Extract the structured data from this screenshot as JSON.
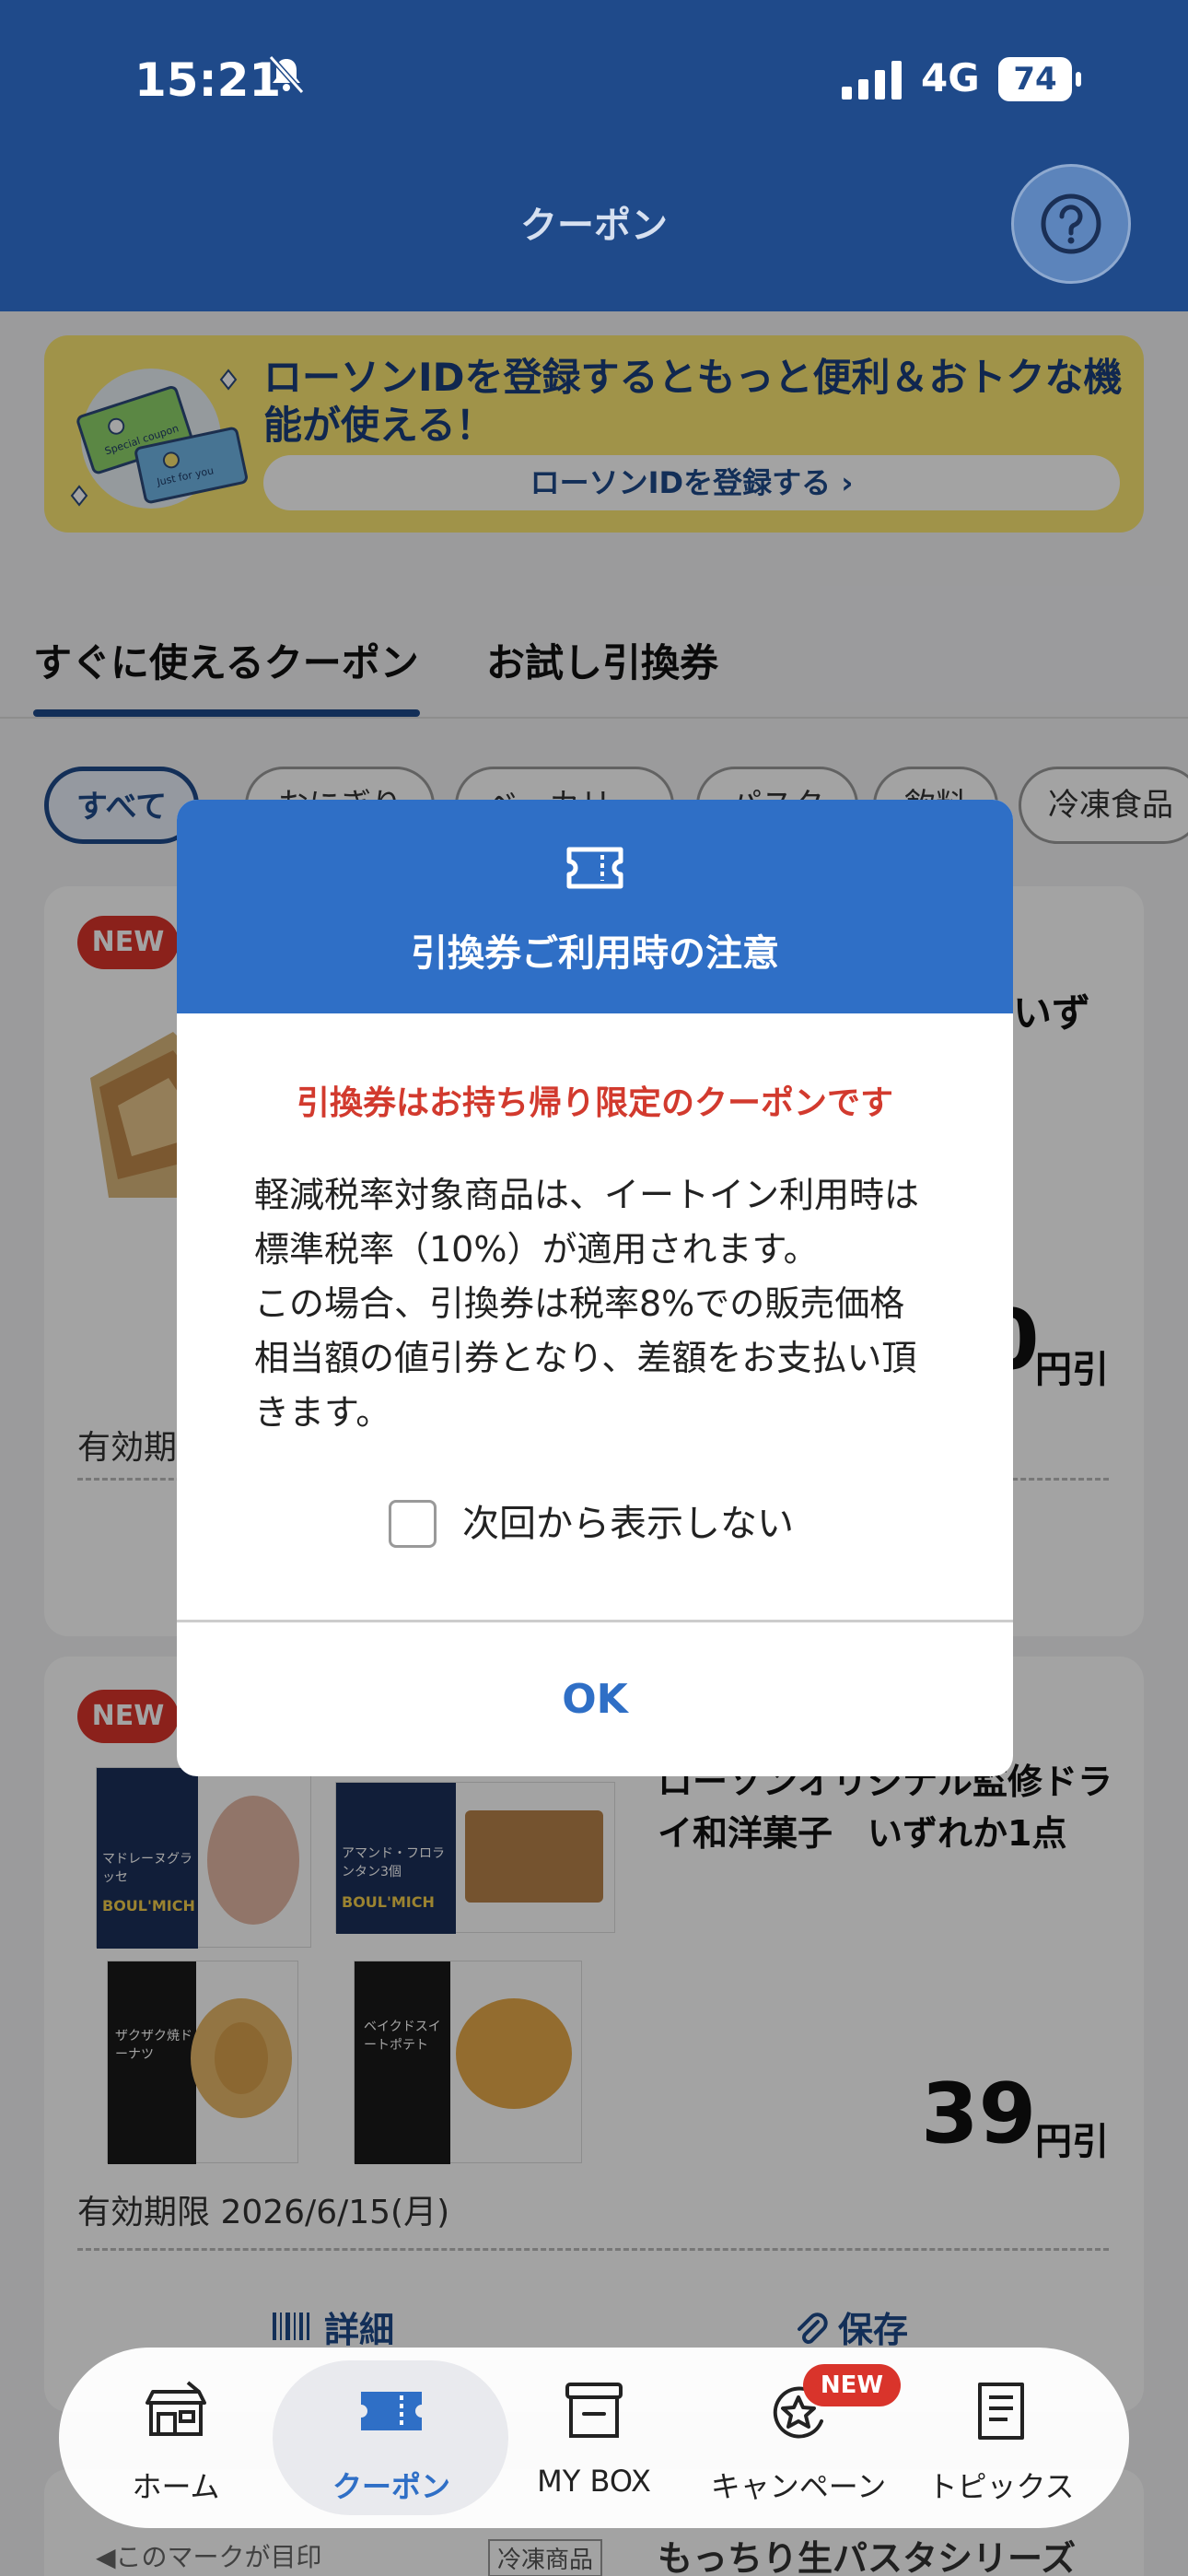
{
  "status_bar": {
    "time": "15:21",
    "network": "4G",
    "battery": "74"
  },
  "header": {
    "title": "クーポン"
  },
  "banner": {
    "text": "ローソンIDを登録するともっと便利＆おトクな機能が使える！",
    "link": "ローソンIDを登録する ›",
    "art_texts": [
      "Special coupon",
      "Just for you"
    ]
  },
  "tabs": [
    {
      "label": "すぐに使えるクーポン",
      "active": true
    },
    {
      "label": "お試し引換券",
      "active": false
    }
  ],
  "chips": [
    "すべて",
    "おにぎり",
    "ベーカリー",
    "パスタ",
    "飲料",
    "冷凍食品"
  ],
  "cards": [
    {
      "badge": "NEW",
      "title_fragment": "いず",
      "discount_value_fragment": "0",
      "discount_unit": "円引",
      "expiry_prefix": "有効期"
    },
    {
      "badge": "NEW",
      "title": "ローソンオリジナル監修ドライ和洋菓子　いずれか1点",
      "discount_value": "39",
      "discount_unit": "円引",
      "expiry": "有効期限 2026/6/15(月)",
      "actions": {
        "details": "詳細",
        "save": "保存"
      },
      "products": [
        {
          "name": "マドレーヌグラッセ",
          "brand": "BOUL'MICH"
        },
        {
          "name": "アマンド・フロランタン3個",
          "brand": "BOUL'MICH"
        },
        {
          "name": "ザクザク焼ドーナツ",
          "brand": ""
        },
        {
          "name": "ベイクドスイートポテト",
          "brand": ""
        }
      ]
    }
  ],
  "peek_row": {
    "mark_note": "◀このマークが目印",
    "tag": "冷凍商品",
    "title": "もっちり生パスタシリーズ"
  },
  "modal": {
    "title": "引換券ご利用時の注意",
    "warning": "引換券はお持ち帰り限定のクーポンです",
    "body_lines": [
      "軽減税率対象商品は、イートイン利用時は",
      "標準税率（10%）が適用されます。",
      "この場合、引換券は税率8%での販売価格",
      "相当額の値引券となり、差額をお支払い頂",
      "きます。"
    ],
    "checkbox_label": "次回から表示しない",
    "ok_label": "OK"
  },
  "bottom_nav": {
    "items": [
      {
        "label": "ホーム",
        "icon": "home-store-icon"
      },
      {
        "label": "クーポン",
        "icon": "coupon-ticket-icon",
        "active": true
      },
      {
        "label": "MY BOX",
        "icon": "box-icon"
      },
      {
        "label": "キャンペーン",
        "icon": "campaign-star-icon",
        "badge": "NEW"
      },
      {
        "label": "トピックス",
        "icon": "topics-document-icon"
      }
    ]
  },
  "colors": {
    "header": "#1f4a8a",
    "modal_header": "#2f6fc6",
    "warning": "#d23a2e",
    "banner": "#fbe672",
    "new_badge": "#d9342b"
  }
}
